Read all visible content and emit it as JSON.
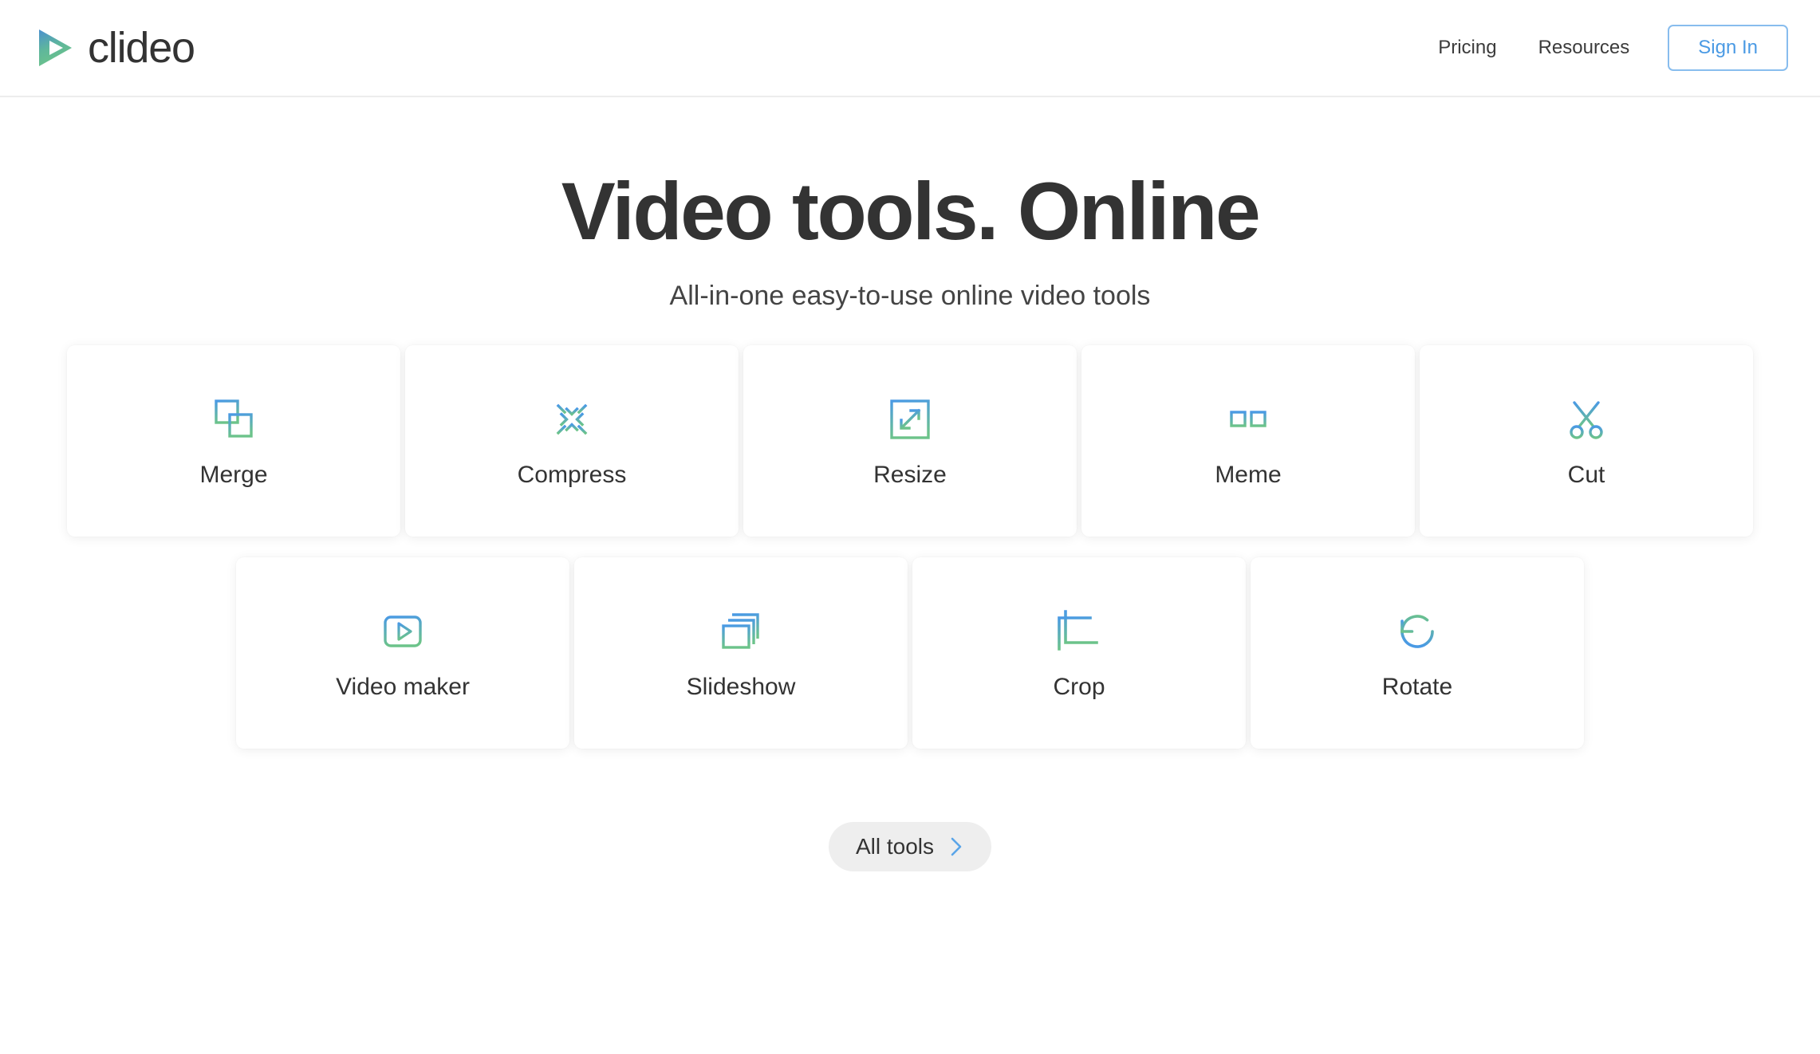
{
  "brand": {
    "name": "clideo",
    "logo_icon": "play-triangle-logo",
    "gradient_from": "#4a9ae4",
    "gradient_to": "#6cc38a"
  },
  "header": {
    "nav": [
      {
        "label": "Pricing",
        "name": "nav-link-pricing"
      },
      {
        "label": "Resources",
        "name": "nav-link-resources"
      }
    ],
    "sign_in_label": "Sign In",
    "sign_in_color": "#4a9ae4",
    "border_color": "#ededed"
  },
  "hero": {
    "title": "Video tools. Online",
    "subtitle": "All-in-one easy-to-use online video tools"
  },
  "tools": {
    "row1": [
      {
        "label": "Merge",
        "icon": "merge-squares-icon"
      },
      {
        "label": "Compress",
        "icon": "compress-arrows-icon"
      },
      {
        "label": "Resize",
        "icon": "resize-expand-icon"
      },
      {
        "label": "Meme",
        "icon": "glasses-icon"
      },
      {
        "label": "Cut",
        "icon": "scissors-icon"
      }
    ],
    "row2": [
      {
        "label": "Video maker",
        "icon": "play-box-icon"
      },
      {
        "label": "Slideshow",
        "icon": "stacked-frames-icon"
      },
      {
        "label": "Crop",
        "icon": "crop-marks-icon"
      },
      {
        "label": "Rotate",
        "icon": "rotate-ccw-icon"
      }
    ]
  },
  "footer_cta": {
    "label": "All tools",
    "chevron_icon": "chevron-right-icon",
    "chevron_color": "#4a9ae4",
    "background": "#eeeeee"
  }
}
